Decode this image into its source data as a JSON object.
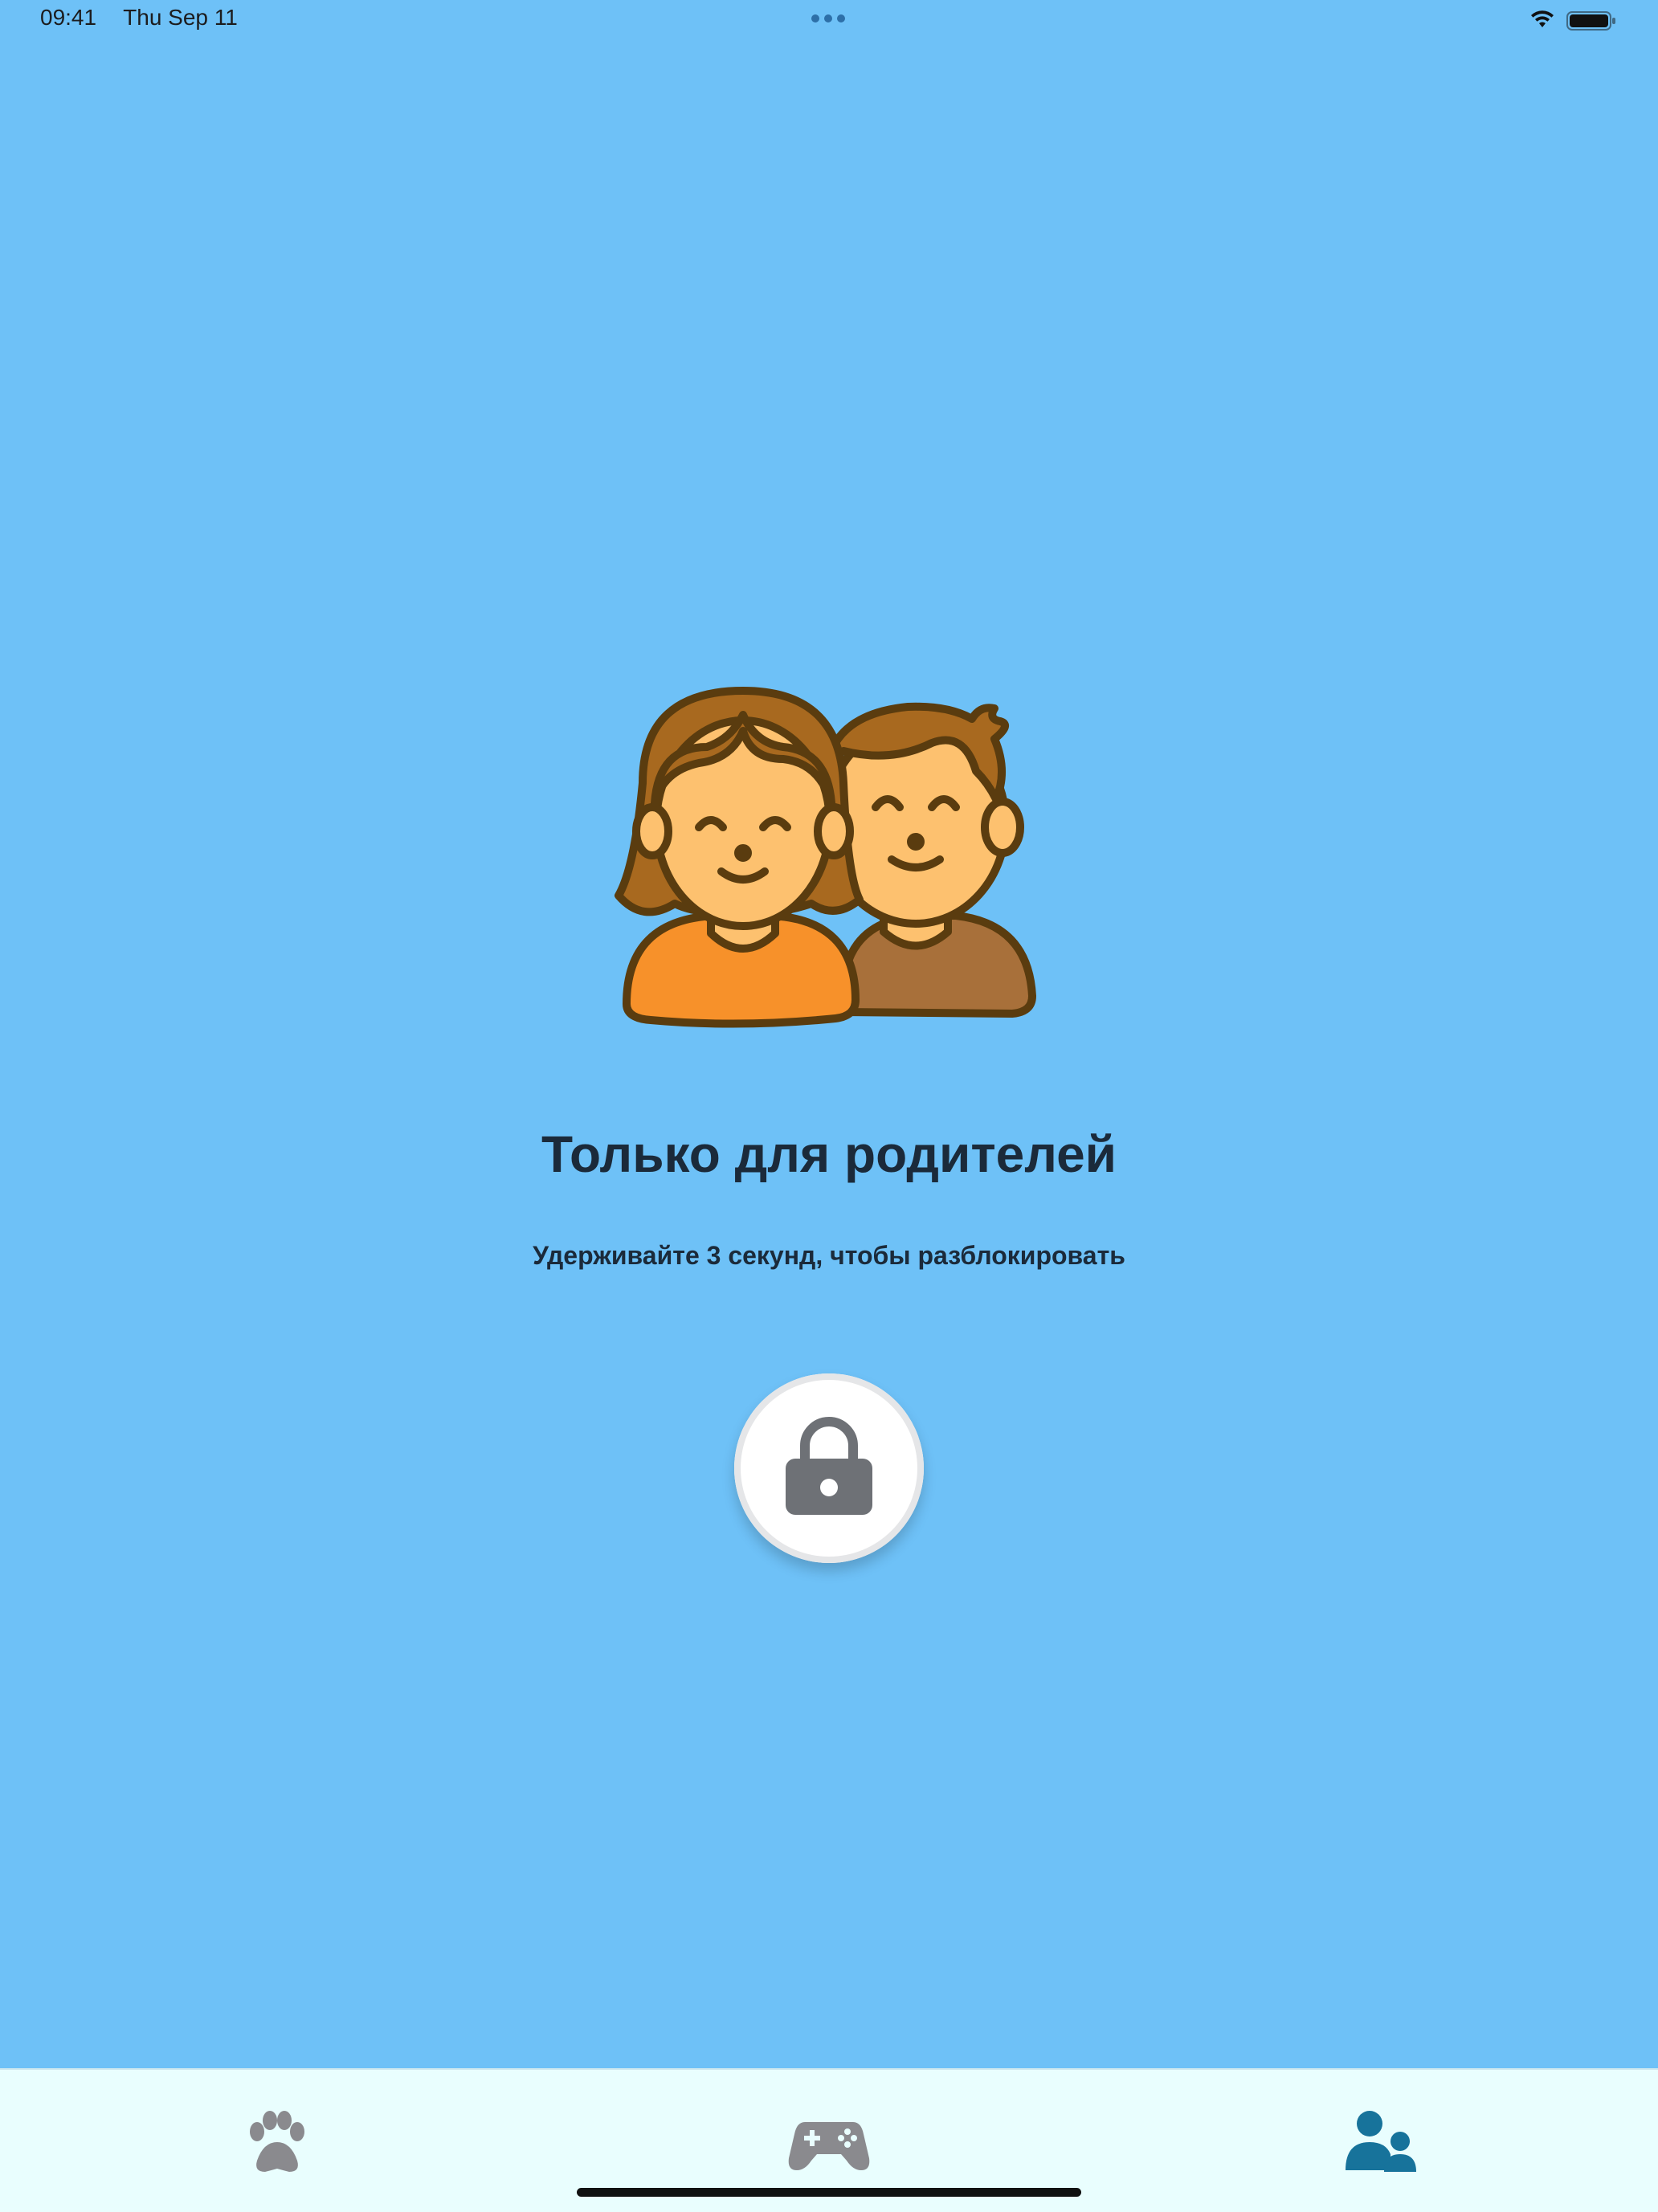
{
  "status_bar": {
    "time": "09:41",
    "date": "Thu Sep 11",
    "icons": [
      "more-dots-icon",
      "wifi-icon",
      "battery-icon"
    ]
  },
  "main": {
    "illustration": "parents-icon",
    "title": "Только для родителей",
    "subtitle": "Удерживайте 3 секунд, чтобы разблокировать",
    "lock_button_icon": "lock-icon"
  },
  "tab_bar": {
    "tabs": [
      {
        "icon": "paw-icon",
        "active": false
      },
      {
        "icon": "gamepad-icon",
        "active": false
      },
      {
        "icon": "parents-tab-icon",
        "active": true
      }
    ]
  },
  "colors": {
    "background": "#6EC1F7",
    "tabbar_background": "#E9FEFE",
    "active_tab": "#17739B",
    "inactive_tab": "#8A8A8E",
    "text": "#1B2A3A"
  }
}
